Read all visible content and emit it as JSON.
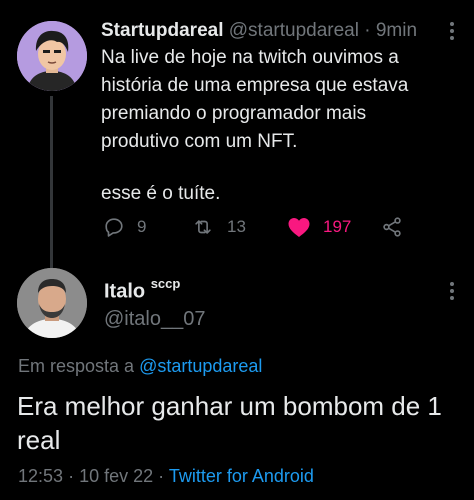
{
  "original_tweet": {
    "author_name": "Startupdareal",
    "handle": "@startupdareal",
    "separator": "·",
    "time_ago": "9min",
    "text_lines": [
      "Na live de hoje na twitch ouvimos a",
      "história de uma empresa que estava",
      "premiando o programador mais",
      "produtivo com um NFT."
    ],
    "text_last": "esse é o tuíte.",
    "actions": {
      "replies": "9",
      "retweets": "13",
      "likes": "197"
    }
  },
  "reply_tweet": {
    "author_name": "Italo",
    "name_suffix": "sccp",
    "handle": "@italo__07",
    "reply_prefix": "Em resposta a",
    "reply_target": "@startupdareal",
    "text": "Era melhor ganhar um bombom de 1 real",
    "time": "12:53",
    "date": "10 fev 22",
    "separator": "·",
    "source": "Twitter for Android"
  },
  "colors": {
    "background": "#000000",
    "text": "#e7e9ea",
    "muted": "#71767b",
    "link": "#1d9bf0",
    "like": "#f91880"
  }
}
